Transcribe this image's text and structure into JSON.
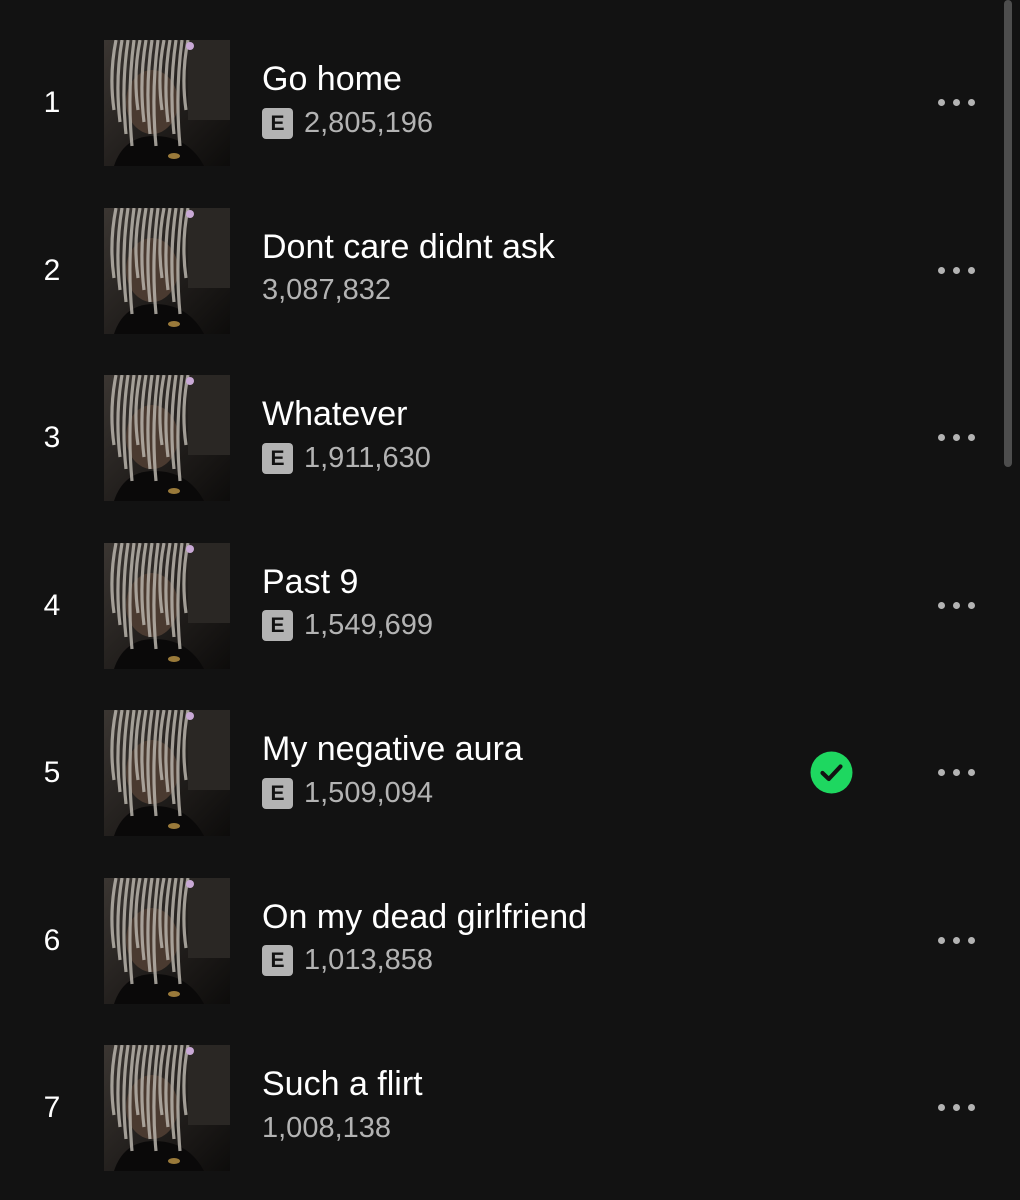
{
  "tracks": [
    {
      "number": "1",
      "title": "Go home",
      "explicit": true,
      "explicit_label": "E",
      "plays": "2,805,196",
      "saved": false
    },
    {
      "number": "2",
      "title": "Dont care didnt ask",
      "explicit": false,
      "explicit_label": "",
      "plays": "3,087,832",
      "saved": false
    },
    {
      "number": "3",
      "title": "Whatever",
      "explicit": true,
      "explicit_label": "E",
      "plays": "1,911,630",
      "saved": false
    },
    {
      "number": "4",
      "title": "Past 9",
      "explicit": true,
      "explicit_label": "E",
      "plays": "1,549,699",
      "saved": false
    },
    {
      "number": "5",
      "title": "My negative aura",
      "explicit": true,
      "explicit_label": "E",
      "plays": "1,509,094",
      "saved": true
    },
    {
      "number": "6",
      "title": "On my dead girlfriend",
      "explicit": true,
      "explicit_label": "E",
      "plays": "1,013,858",
      "saved": false
    },
    {
      "number": "7",
      "title": "Such a flirt",
      "explicit": false,
      "explicit_label": "",
      "plays": "1,008,138",
      "saved": false
    }
  ],
  "icons": {
    "saved": "check-circle-icon",
    "more": "more-horizontal-icon"
  },
  "colors": {
    "background": "#121212",
    "primary_text": "#ffffff",
    "secondary_text": "#b3b3b3",
    "accent_green": "#1ed760"
  }
}
